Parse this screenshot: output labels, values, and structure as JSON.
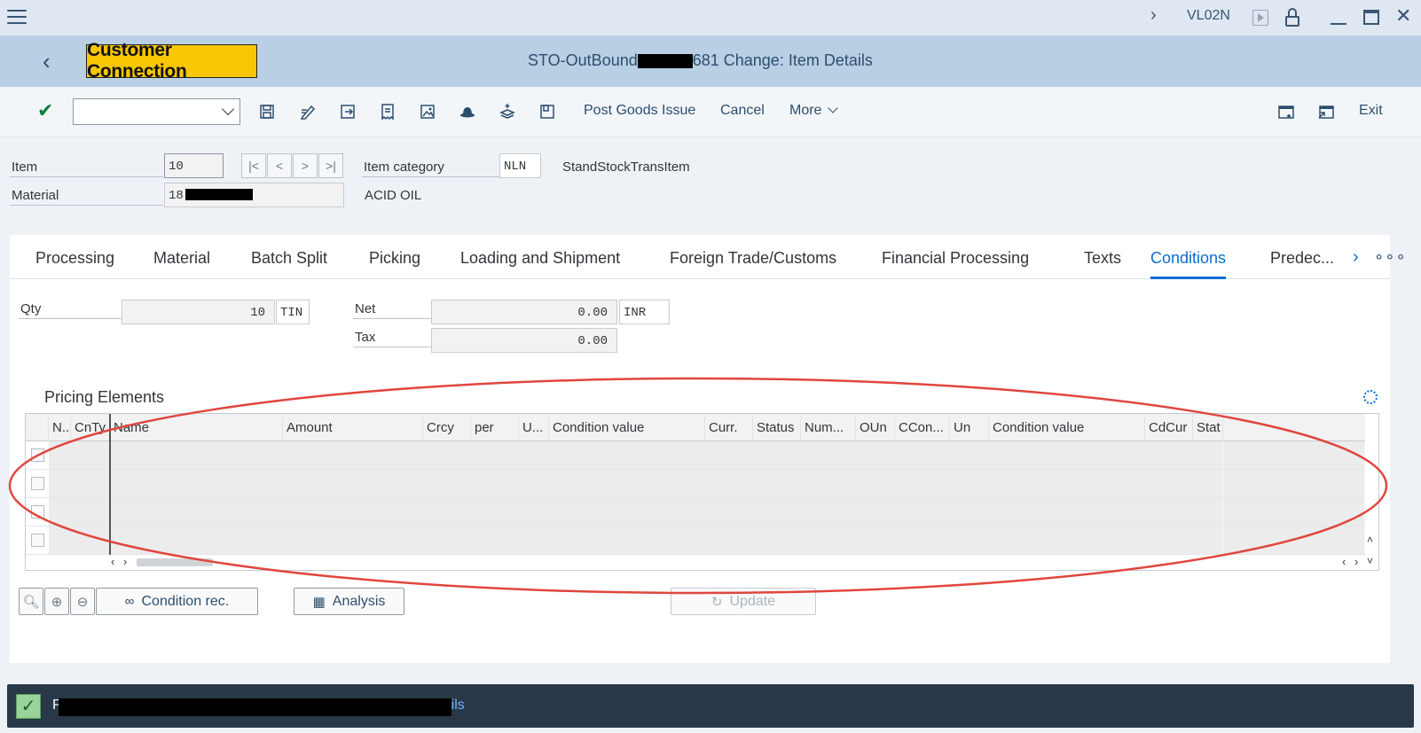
{
  "shell": {
    "transaction_code": "VL02N",
    "icons": [
      "menu-icon",
      "chevron-right-icon",
      "play-icon",
      "lock-icon",
      "minimize-icon",
      "maximize-icon",
      "close-icon"
    ]
  },
  "titlebar": {
    "logo_text": "Customer Connection",
    "title_prefix": "STO-OutBound",
    "title_suffix": "681 Change: Item Details"
  },
  "toolbar": {
    "command_field_value": "",
    "post_goods_issue": "Post Goods Issue",
    "cancel": "Cancel",
    "more": "More",
    "exit": "Exit"
  },
  "header": {
    "item_label": "Item",
    "item_value": "10",
    "material_label": "Material",
    "material_value": "18",
    "item_category_label": "Item category",
    "item_category_value": "NLN",
    "item_category_desc": "StandStockTransItem",
    "material_desc": "ACID OIL",
    "nav_first": "|<",
    "nav_prev": "<",
    "nav_next": ">",
    "nav_last": ">|"
  },
  "tabs": [
    {
      "label": "Processing"
    },
    {
      "label": "Material"
    },
    {
      "label": "Batch Split"
    },
    {
      "label": "Picking"
    },
    {
      "label": "Loading and Shipment"
    },
    {
      "label": "Foreign Trade/Customs"
    },
    {
      "label": "Financial Processing"
    },
    {
      "label": "Texts"
    },
    {
      "label": "Conditions"
    },
    {
      "label": "Predec..."
    }
  ],
  "active_tab": "Conditions",
  "conditions": {
    "qty_label": "Qty",
    "qty_value": "10",
    "qty_unit": "TIN",
    "net_label": "Net",
    "net_value": "0.00",
    "net_currency": "INR",
    "tax_label": "Tax",
    "tax_value": "0.00"
  },
  "pricing": {
    "title": "Pricing Elements",
    "columns": [
      "N..",
      "CnTy",
      "Name",
      "Amount",
      "Crcy",
      "per",
      "U...",
      "Condition value",
      "Curr.",
      "Status",
      "Num...",
      "OUn",
      "CCon...",
      "Un",
      "Condition value",
      "CdCur",
      "Stat"
    ],
    "row_count": 4
  },
  "buttons": {
    "condition_rec": "Condition rec.",
    "analysis": "Analysis",
    "update": "Update"
  },
  "status_bar": {
    "message_prefix": "P",
    "message_suffix": "ils"
  },
  "colors": {
    "shell_bg": "#dfe8f2",
    "title_bg": "#b9cfe4",
    "logo_bg": "#f9c606",
    "accent": "#0a6ed1",
    "status_bg": "#283848",
    "annotation": "#e0463e"
  }
}
